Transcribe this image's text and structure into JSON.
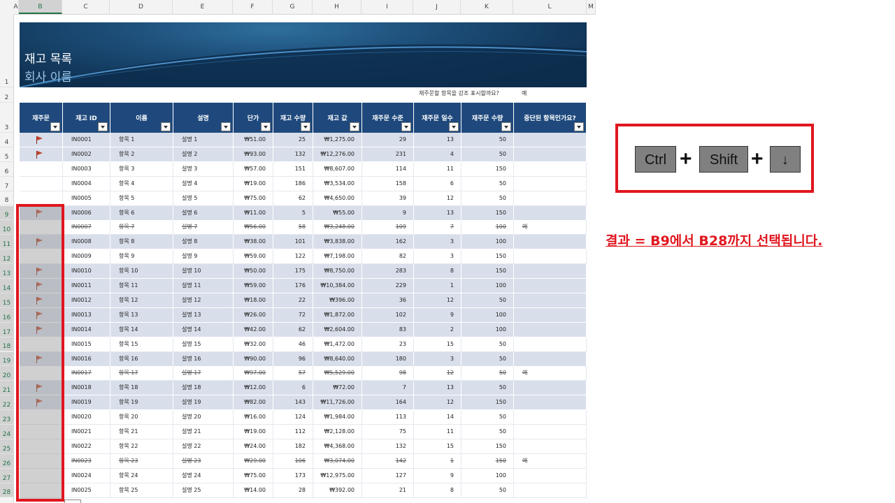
{
  "columns": [
    "A",
    "B",
    "C",
    "D",
    "E",
    "F",
    "G",
    "H",
    "I",
    "J",
    "K",
    "L",
    "M"
  ],
  "banner": {
    "title": "재고 목록",
    "subtitle": "회사 이름"
  },
  "highlight_question": {
    "label": "재주문할 항목을 강조 표시할까요?",
    "value": "예"
  },
  "table": {
    "headers": [
      "재주문",
      "재고 ID",
      "이름",
      "설명",
      "단가",
      "재고 수량",
      "재고 값",
      "재주문 수준",
      "재주문 일수",
      "재주문 수량",
      "중단된 항목인가요?"
    ],
    "rows": [
      {
        "row": "4",
        "flag": true,
        "disc": false,
        "id": "IN0001",
        "name": "항목 1",
        "desc": "설명 1",
        "price": "₩51.00",
        "qty": "25",
        "value": "₩1,275.00",
        "level": "29",
        "days": "13",
        "reorder_qty": "50",
        "discontinued": ""
      },
      {
        "row": "5",
        "flag": true,
        "disc": false,
        "id": "IN0002",
        "name": "항목 2",
        "desc": "설명 2",
        "price": "₩93.00",
        "qty": "132",
        "value": "₩12,276.00",
        "level": "231",
        "days": "4",
        "reorder_qty": "50",
        "discontinued": ""
      },
      {
        "row": "6",
        "flag": false,
        "disc": false,
        "id": "IN0003",
        "name": "항목 3",
        "desc": "설명 3",
        "price": "₩57.00",
        "qty": "151",
        "value": "₩8,607.00",
        "level": "114",
        "days": "11",
        "reorder_qty": "150",
        "discontinued": ""
      },
      {
        "row": "7",
        "flag": false,
        "disc": false,
        "id": "IN0004",
        "name": "항목 4",
        "desc": "설명 4",
        "price": "₩19.00",
        "qty": "186",
        "value": "₩3,534.00",
        "level": "158",
        "days": "6",
        "reorder_qty": "50",
        "discontinued": ""
      },
      {
        "row": "8",
        "flag": false,
        "disc": false,
        "id": "IN0005",
        "name": "항목 5",
        "desc": "설명 5",
        "price": "₩75.00",
        "qty": "62",
        "value": "₩4,650.00",
        "level": "39",
        "days": "12",
        "reorder_qty": "50",
        "discontinued": ""
      },
      {
        "row": "9",
        "flag": true,
        "disc": false,
        "id": "IN0006",
        "name": "항목 6",
        "desc": "설명 6",
        "price": "₩11.00",
        "qty": "5",
        "value": "₩55.00",
        "level": "9",
        "days": "13",
        "reorder_qty": "150",
        "discontinued": ""
      },
      {
        "row": "10",
        "flag": false,
        "disc": true,
        "id": "IN0007",
        "name": "항목 7",
        "desc": "설명 7",
        "price": "₩56.00",
        "qty": "58",
        "value": "₩3,248.00",
        "level": "109",
        "days": "7",
        "reorder_qty": "100",
        "discontinued": "예"
      },
      {
        "row": "11",
        "flag": true,
        "disc": false,
        "id": "IN0008",
        "name": "항목 8",
        "desc": "설명 8",
        "price": "₩38.00",
        "qty": "101",
        "value": "₩3,838.00",
        "level": "162",
        "days": "3",
        "reorder_qty": "100",
        "discontinued": ""
      },
      {
        "row": "12",
        "flag": false,
        "disc": false,
        "id": "IN0009",
        "name": "항목 9",
        "desc": "설명 9",
        "price": "₩59.00",
        "qty": "122",
        "value": "₩7,198.00",
        "level": "82",
        "days": "3",
        "reorder_qty": "150",
        "discontinued": ""
      },
      {
        "row": "13",
        "flag": true,
        "disc": false,
        "id": "IN0010",
        "name": "항목 10",
        "desc": "설명 10",
        "price": "₩50.00",
        "qty": "175",
        "value": "₩8,750.00",
        "level": "283",
        "days": "8",
        "reorder_qty": "150",
        "discontinued": ""
      },
      {
        "row": "14",
        "flag": true,
        "disc": false,
        "id": "IN0011",
        "name": "항목 11",
        "desc": "설명 11",
        "price": "₩59.00",
        "qty": "176",
        "value": "₩10,384.00",
        "level": "229",
        "days": "1",
        "reorder_qty": "100",
        "discontinued": ""
      },
      {
        "row": "15",
        "flag": true,
        "disc": false,
        "id": "IN0012",
        "name": "항목 12",
        "desc": "설명 12",
        "price": "₩18.00",
        "qty": "22",
        "value": "₩396.00",
        "level": "36",
        "days": "12",
        "reorder_qty": "50",
        "discontinued": ""
      },
      {
        "row": "16",
        "flag": true,
        "disc": false,
        "id": "IN0013",
        "name": "항목 13",
        "desc": "설명 13",
        "price": "₩26.00",
        "qty": "72",
        "value": "₩1,872.00",
        "level": "102",
        "days": "9",
        "reorder_qty": "100",
        "discontinued": ""
      },
      {
        "row": "17",
        "flag": true,
        "disc": false,
        "id": "IN0014",
        "name": "항목 14",
        "desc": "설명 14",
        "price": "₩42.00",
        "qty": "62",
        "value": "₩2,604.00",
        "level": "83",
        "days": "2",
        "reorder_qty": "100",
        "discontinued": ""
      },
      {
        "row": "18",
        "flag": false,
        "disc": false,
        "id": "IN0015",
        "name": "항목 15",
        "desc": "설명 15",
        "price": "₩32.00",
        "qty": "46",
        "value": "₩1,472.00",
        "level": "23",
        "days": "15",
        "reorder_qty": "50",
        "discontinued": ""
      },
      {
        "row": "19",
        "flag": true,
        "disc": false,
        "id": "IN0016",
        "name": "항목 16",
        "desc": "설명 16",
        "price": "₩90.00",
        "qty": "96",
        "value": "₩8,640.00",
        "level": "180",
        "days": "3",
        "reorder_qty": "50",
        "discontinued": ""
      },
      {
        "row": "20",
        "flag": false,
        "disc": true,
        "id": "IN0017",
        "name": "항목 17",
        "desc": "설명 17",
        "price": "₩97.00",
        "qty": "57",
        "value": "₩5,529.00",
        "level": "98",
        "days": "12",
        "reorder_qty": "50",
        "discontinued": "예"
      },
      {
        "row": "21",
        "flag": true,
        "disc": false,
        "id": "IN0018",
        "name": "항목 18",
        "desc": "설명 18",
        "price": "₩12.00",
        "qty": "6",
        "value": "₩72.00",
        "level": "7",
        "days": "13",
        "reorder_qty": "50",
        "discontinued": ""
      },
      {
        "row": "22",
        "flag": true,
        "disc": false,
        "id": "IN0019",
        "name": "항목 19",
        "desc": "설명 19",
        "price": "₩82.00",
        "qty": "143",
        "value": "₩11,726.00",
        "level": "164",
        "days": "12",
        "reorder_qty": "150",
        "discontinued": ""
      },
      {
        "row": "23",
        "flag": false,
        "disc": false,
        "id": "IN0020",
        "name": "항목 20",
        "desc": "설명 20",
        "price": "₩16.00",
        "qty": "124",
        "value": "₩1,984.00",
        "level": "113",
        "days": "14",
        "reorder_qty": "50",
        "discontinued": ""
      },
      {
        "row": "24",
        "flag": false,
        "disc": false,
        "id": "IN0021",
        "name": "항목 21",
        "desc": "설명 21",
        "price": "₩19.00",
        "qty": "112",
        "value": "₩2,128.00",
        "level": "75",
        "days": "11",
        "reorder_qty": "50",
        "discontinued": ""
      },
      {
        "row": "25",
        "flag": false,
        "disc": false,
        "id": "IN0022",
        "name": "항목 22",
        "desc": "설명 22",
        "price": "₩24.00",
        "qty": "182",
        "value": "₩4,368.00",
        "level": "132",
        "days": "15",
        "reorder_qty": "150",
        "discontinued": ""
      },
      {
        "row": "26",
        "flag": false,
        "disc": true,
        "id": "IN0023",
        "name": "항목 23",
        "desc": "설명 23",
        "price": "₩29.00",
        "qty": "106",
        "value": "₩3,074.00",
        "level": "142",
        "days": "1",
        "reorder_qty": "150",
        "discontinued": "예"
      },
      {
        "row": "27",
        "flag": false,
        "disc": false,
        "id": "IN0024",
        "name": "항목 24",
        "desc": "설명 24",
        "price": "₩75.00",
        "qty": "173",
        "value": "₩12,975.00",
        "level": "127",
        "days": "9",
        "reorder_qty": "100",
        "discontinued": ""
      },
      {
        "row": "28",
        "flag": false,
        "disc": false,
        "id": "IN0025",
        "name": "항목 25",
        "desc": "설명 25",
        "price": "₩14.00",
        "qty": "28",
        "value": "₩392.00",
        "level": "21",
        "days": "8",
        "reorder_qty": "50",
        "discontinued": ""
      }
    ]
  },
  "shortcut": {
    "keys": [
      "Ctrl",
      "Shift",
      "↓"
    ],
    "plus": "+"
  },
  "result_text": "결과 = B9에서 B28까지 선택됩니다.",
  "colors": {
    "header": "#1f497d",
    "band": "#d8deea",
    "annotation_red": "#e0161f",
    "key_gray": "#808080"
  },
  "icons": {
    "reorder_flag": "flag-icon",
    "filter_dropdown": "dropdown-arrow-icon"
  }
}
